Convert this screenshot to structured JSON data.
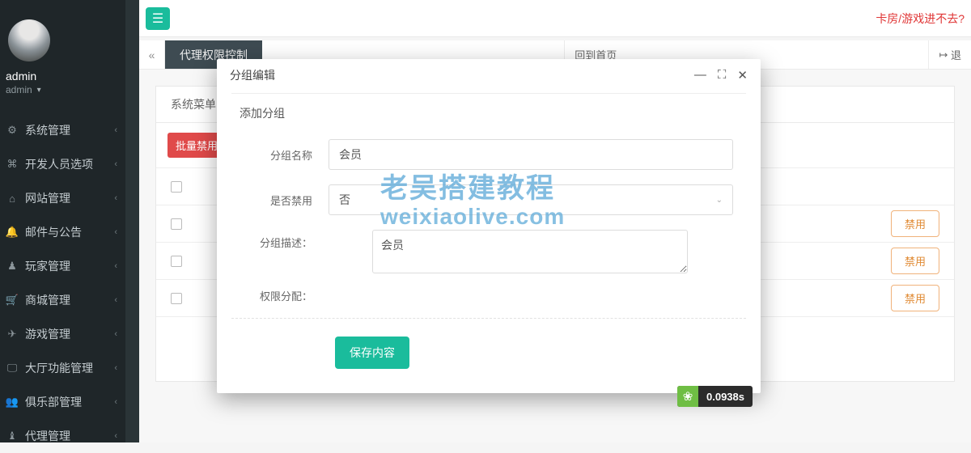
{
  "user": {
    "name": "admin",
    "role": "admin"
  },
  "sidebar": {
    "items": [
      {
        "icon": "⚙",
        "label": "系统管理"
      },
      {
        "icon": "⌘",
        "label": "开发人员选项"
      },
      {
        "icon": "⌂",
        "label": "网站管理"
      },
      {
        "icon": "🔔",
        "label": "邮件与公告"
      },
      {
        "icon": "♟",
        "label": "玩家管理"
      },
      {
        "icon": "🛒",
        "label": "商城管理"
      },
      {
        "icon": "✈",
        "label": "游戏管理"
      },
      {
        "icon": "🖵",
        "label": "大厅功能管理"
      },
      {
        "icon": "👥",
        "label": "俱乐部管理"
      },
      {
        "icon": "♝",
        "label": "代理管理"
      }
    ]
  },
  "header": {
    "alert": "卡房/游戏进不去?"
  },
  "tabbar": {
    "active_tab": "代理权限控制",
    "home_label": "回到首页",
    "logout_label": "退"
  },
  "page": {
    "panel_tab": "系统菜单",
    "bulk_disable": "批量禁用",
    "disable_chip": "禁用"
  },
  "modal": {
    "title": "分组编辑",
    "section_title": "添加分组",
    "labels": {
      "group_name": "分组名称",
      "is_disabled": "是否禁用",
      "group_desc": "分组描述：",
      "perm_assign": "权限分配："
    },
    "values": {
      "group_name": "会员",
      "is_disabled": "否",
      "group_desc": "会员"
    },
    "save_btn": "保存内容"
  },
  "timer": {
    "value": "0.0938s"
  },
  "watermark": {
    "line1": "老吴搭建教程",
    "line2": "weixiaolive.com"
  }
}
